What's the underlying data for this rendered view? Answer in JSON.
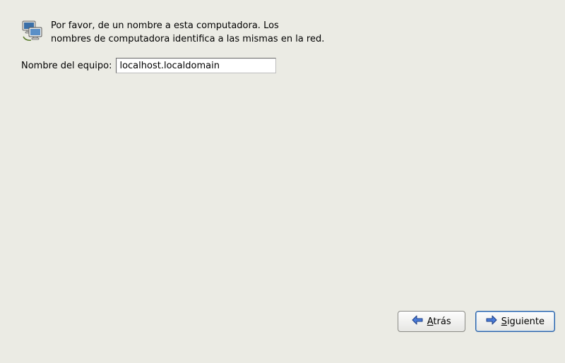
{
  "header": {
    "desc_line1": "Por favor, de un nombre a esta computadora. Los",
    "desc_line2": "nombres de computadora identifica a las mismas en la red.",
    "icon": "computer-network-icon"
  },
  "hostname": {
    "label": "Nombre del equipo:",
    "value": "localhost.localdomain"
  },
  "buttons": {
    "back": {
      "mnemonic": "A",
      "rest": "trás"
    },
    "next": {
      "mnemonic": "S",
      "rest": "iguiente"
    }
  }
}
